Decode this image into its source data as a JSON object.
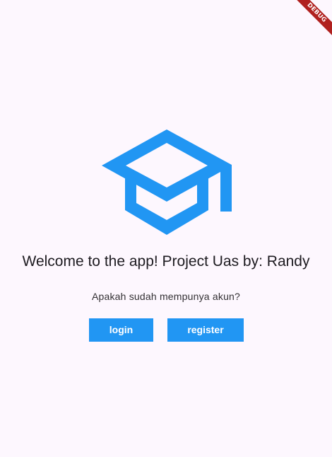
{
  "debug_banner": {
    "label": "DEBUG"
  },
  "logo": {
    "icon": "school-icon",
    "color": "#2196f3"
  },
  "welcome": {
    "title": "Welcome to the app! Project Uas by: Randy",
    "subtitle": "Apakah sudah mempunya akun?"
  },
  "actions": {
    "login_label": "login",
    "register_label": "register",
    "button_color": "#2196f3"
  }
}
